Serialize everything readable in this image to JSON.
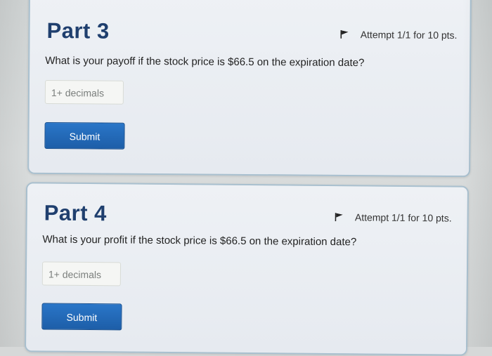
{
  "parts": [
    {
      "title": "Part 3",
      "attempt": "Attempt 1/1 for 10 pts.",
      "question": "What is your payoff if the stock price is $66.5 on the expiration date?",
      "input_placeholder": "1+ decimals",
      "submit_label": "Submit"
    },
    {
      "title": "Part 4",
      "attempt": "Attempt 1/1 for 10 pts.",
      "question": "What is your profit if the stock price is $66.5 on the expiration date?",
      "input_placeholder": "1+ decimals",
      "submit_label": "Submit"
    }
  ],
  "icons": {
    "flag": "flag-icon"
  },
  "colors": {
    "title": "#1f3f6e",
    "submit_bg": "#2a76c8",
    "card_border": "#a9c0cf"
  }
}
